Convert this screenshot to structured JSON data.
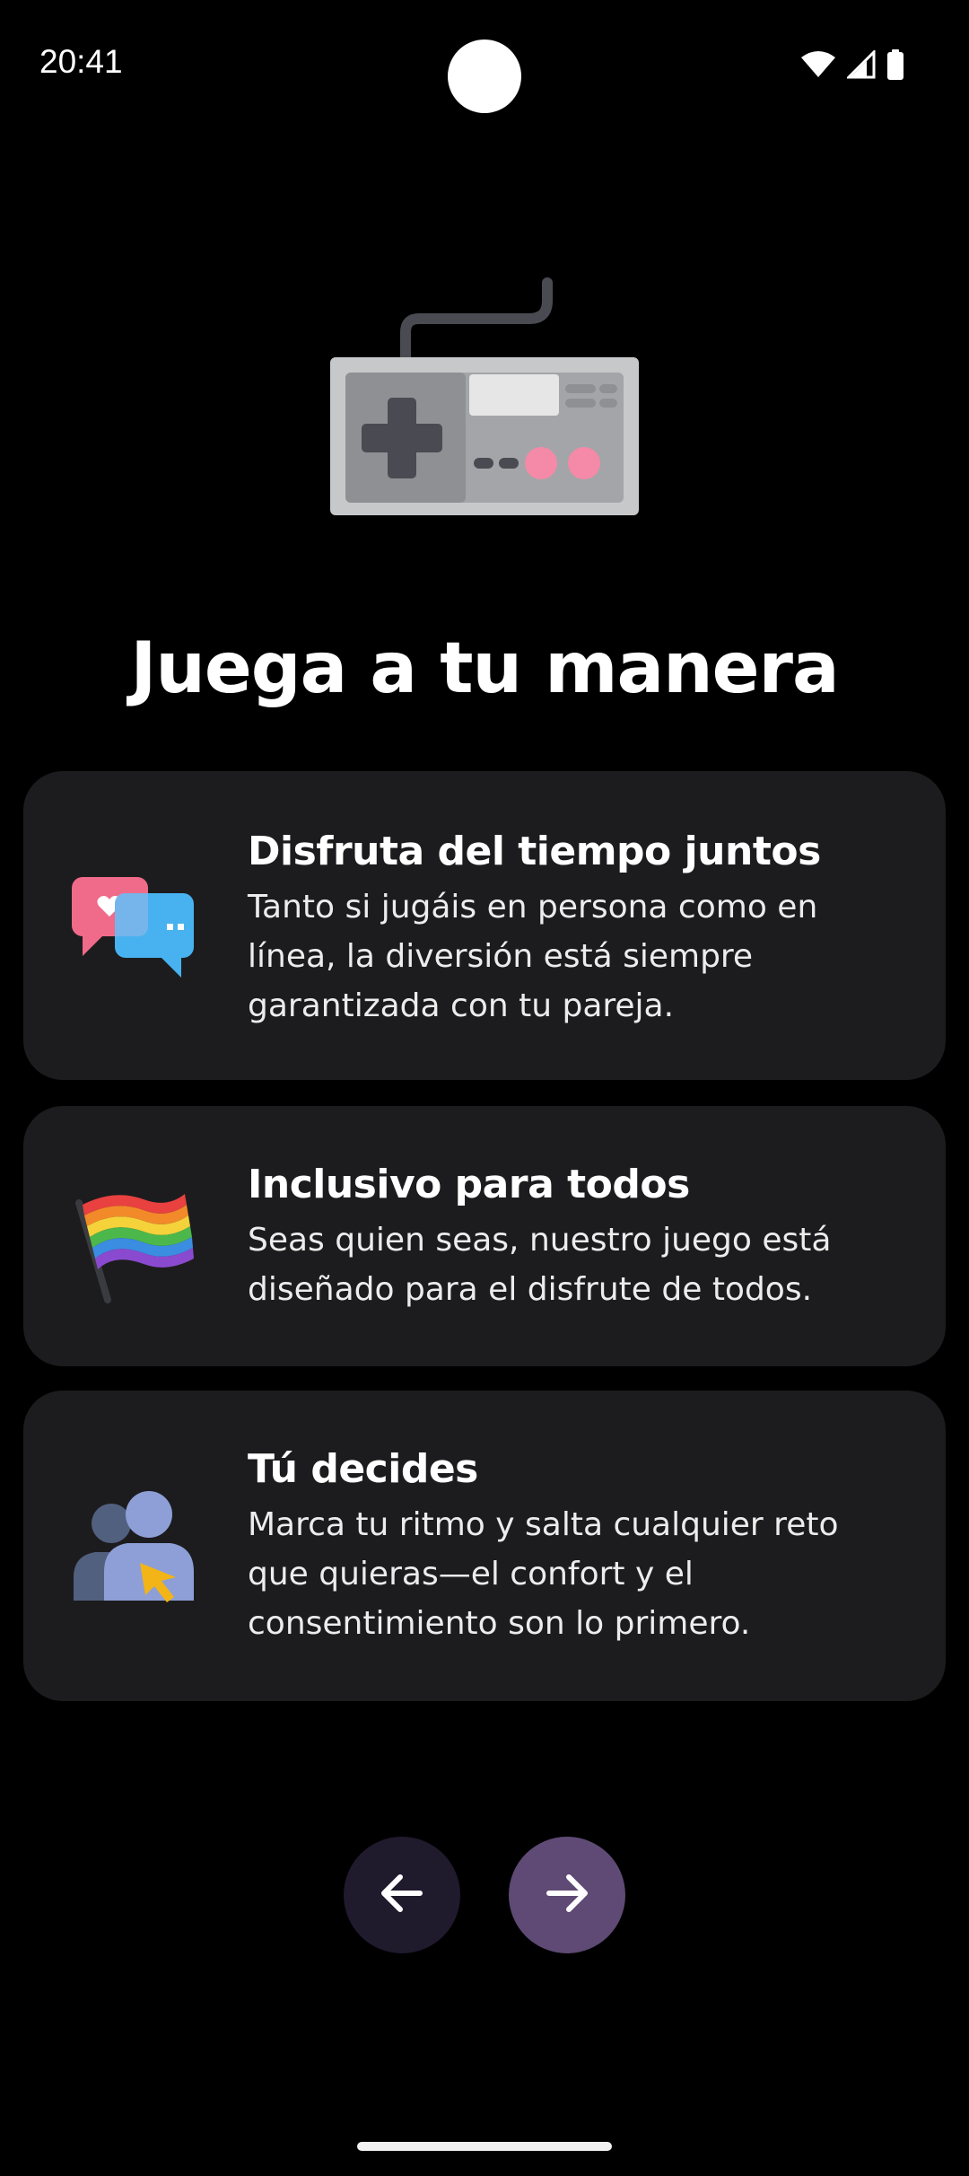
{
  "status_bar": {
    "time": "20:41",
    "icons": [
      "wifi-icon",
      "signal-icon",
      "battery-icon"
    ]
  },
  "hero": {
    "icon": "game-controller-icon",
    "title": "Juega a tu manera"
  },
  "features": [
    {
      "icon": "chat-bubbles-heart-icon",
      "title": "Disfruta del tiempo juntos",
      "description": "Tanto si jugáis en persona como en línea, la diversión está siempre garantizada con tu pareja."
    },
    {
      "icon": "rainbow-flag-icon",
      "title": "Inclusivo para todos",
      "description": "Seas quien seas, nuestro juego está diseñado para el disfrute de todos."
    },
    {
      "icon": "users-cursor-icon",
      "title": "Tú decides",
      "description": "Marca tu ritmo y salta cualquier reto que quieras—el confort y el consentimiento son lo primero."
    }
  ],
  "navigation": {
    "back_icon": "arrow-left-icon",
    "next_icon": "arrow-right-icon"
  },
  "colors": {
    "background": "#000000",
    "card": "#1c1c1e",
    "back_button": "#201a2d",
    "next_button": "#5e4a74"
  }
}
